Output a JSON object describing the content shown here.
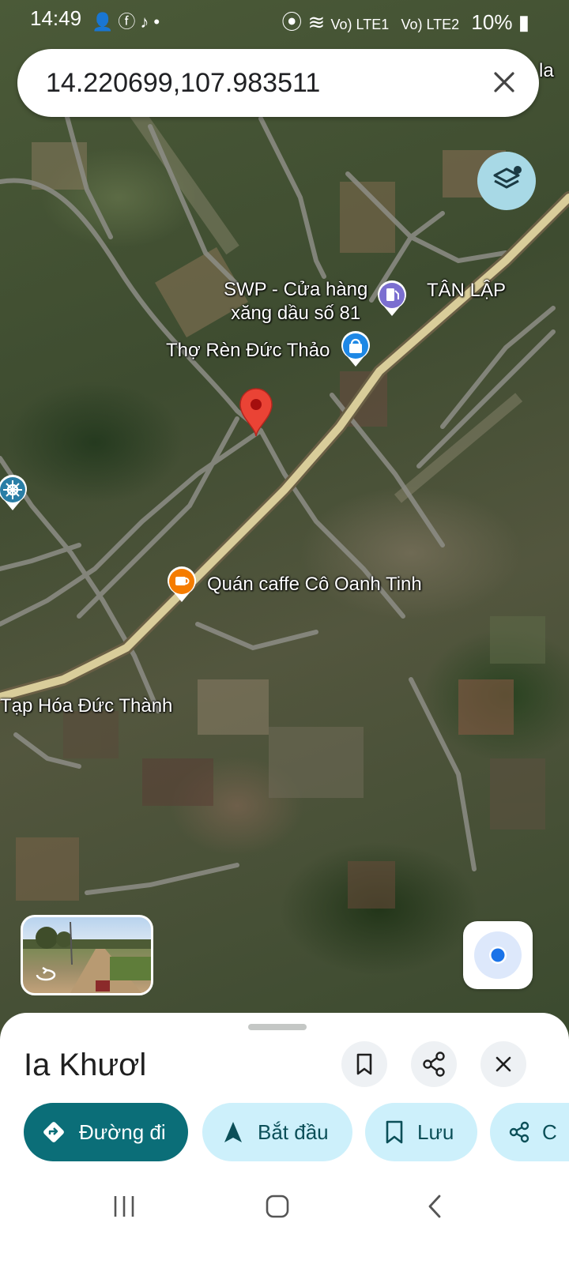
{
  "status_bar": {
    "time": "14:49",
    "left_icons": [
      "person-icon",
      "facebook-icon",
      "tiktok-icon",
      "dot-icon"
    ],
    "signal_labels": [
      "Vo) LTE1",
      "Vo) LTE2"
    ],
    "battery": "10%"
  },
  "search": {
    "query": "14.220699,107.983511",
    "edge_label": "la"
  },
  "map_labels": {
    "gas_station": "SWP - Cửa hàng\nxăng dầu số 81",
    "village": "TÂN LẬP",
    "blacksmith": "Thợ Rèn Đức Thảo",
    "cafe": "Quán caffe Cô Oanh Tinh",
    "grocery": "Tạp Hóa Đức Thành"
  },
  "place": {
    "title": "Ia Khươl"
  },
  "actions": [
    {
      "label": "Đường đi",
      "icon": "directions-icon"
    },
    {
      "label": "Bắt đầu",
      "icon": "navigation-arrow-icon"
    },
    {
      "label": "Lưu",
      "icon": "bookmark-icon"
    },
    {
      "label": "C",
      "icon": "share-icon"
    }
  ],
  "colors": {
    "primary": "#0b6e78",
    "chip_bg": "#cdf0fb",
    "pin": "#ea4335",
    "location_dot": "#1a73e8"
  }
}
